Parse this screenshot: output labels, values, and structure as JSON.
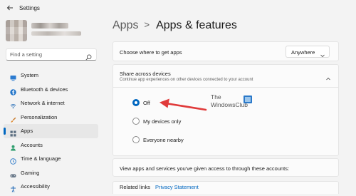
{
  "window": {
    "title": "Settings"
  },
  "search": {
    "placeholder": "Find a setting"
  },
  "sidebar": {
    "items": [
      {
        "label": "System",
        "icon": "monitor-icon"
      },
      {
        "label": "Bluetooth & devices",
        "icon": "bluetooth-icon"
      },
      {
        "label": "Network & internet",
        "icon": "wifi-icon"
      },
      {
        "label": "Personalization",
        "icon": "brush-icon"
      },
      {
        "label": "Apps",
        "icon": "apps-icon",
        "selected": true
      },
      {
        "label": "Accounts",
        "icon": "person-icon"
      },
      {
        "label": "Time & language",
        "icon": "globe-clock-icon"
      },
      {
        "label": "Gaming",
        "icon": "gamepad-icon"
      },
      {
        "label": "Accessibility",
        "icon": "accessibility-icon"
      }
    ]
  },
  "breadcrumb": {
    "parent": "Apps",
    "separator": ">",
    "current": "Apps & features"
  },
  "where": {
    "label": "Choose where to get apps",
    "dropdown_value": "Anywhere"
  },
  "share": {
    "title": "Share across devices",
    "subtitle": "Continue app experiences on other devices connected to your account",
    "options": [
      {
        "label": "Off",
        "checked": true
      },
      {
        "label": "My devices only",
        "checked": false
      },
      {
        "label": "Everyone nearby",
        "checked": false
      }
    ]
  },
  "watermark": {
    "line1": "The",
    "line2": "WindowsClub"
  },
  "accounts_text": "View apps and services you've given access to through these accounts:",
  "related": {
    "title": "Related links",
    "link": "Privacy Statement"
  },
  "colors": {
    "accent": "#0067c0",
    "arrow": "#e03a3a",
    "background": "#f3f3f3",
    "card": "#fbfbfb"
  }
}
